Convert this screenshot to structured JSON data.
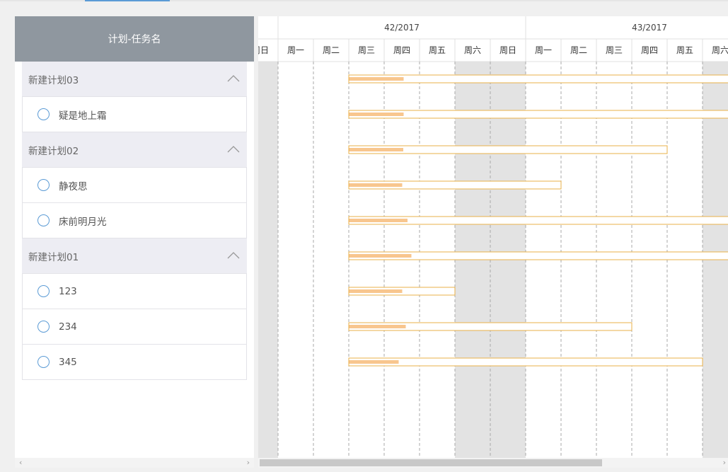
{
  "left": {
    "header": "计划-任务名",
    "rows": [
      {
        "type": "plan",
        "label": "新建计划03"
      },
      {
        "type": "task",
        "label": "疑是地上霜"
      },
      {
        "type": "plan",
        "label": "新建计划02"
      },
      {
        "type": "task",
        "label": "静夜思"
      },
      {
        "type": "task",
        "label": "床前明月光"
      },
      {
        "type": "plan",
        "label": "新建计划01"
      },
      {
        "type": "task",
        "label": "123"
      },
      {
        "type": "task",
        "label": "234"
      },
      {
        "type": "task",
        "label": "345"
      }
    ],
    "scroll_left_arrow": "‹",
    "scroll_right_arrow": "›"
  },
  "gantt": {
    "weeks": [
      "42/2017",
      "43/2017"
    ],
    "days": [
      "周日",
      "周一",
      "周二",
      "周三",
      "周四",
      "周五",
      "周六",
      "周日",
      "周一",
      "周二",
      "周三",
      "周四",
      "周五",
      "周六"
    ],
    "weekend_indices": [
      0,
      6,
      7,
      13
    ],
    "bars": [
      {
        "row": 0,
        "start": 3,
        "end": 14,
        "progress": 0.14
      },
      {
        "row": 1,
        "start": 3,
        "end": 14,
        "progress": 0.14
      },
      {
        "row": 2,
        "start": 3,
        "end": 12,
        "progress": 0.17
      },
      {
        "row": 3,
        "start": 3,
        "end": 9,
        "progress": 0.25
      },
      {
        "row": 4,
        "start": 3,
        "end": 14,
        "progress": 0.15
      },
      {
        "row": 5,
        "start": 3,
        "end": 14,
        "progress": 0.16
      },
      {
        "row": 6,
        "start": 3,
        "end": 6,
        "progress": 0.5
      },
      {
        "row": 7,
        "start": 3,
        "end": 11,
        "progress": 0.2
      },
      {
        "row": 8,
        "start": 3,
        "end": 13,
        "progress": 0.14
      }
    ],
    "colors": {
      "bar_border": "#e8b04a",
      "bar_fill": "#fff",
      "progress": "#f8c68e",
      "weekend": "#e3e3e3",
      "grid": "#aaaaaa"
    },
    "scroll_right_arrow": "›"
  }
}
